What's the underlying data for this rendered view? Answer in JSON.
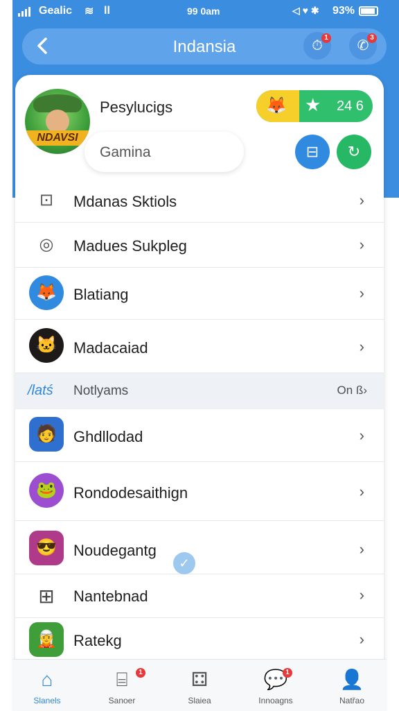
{
  "status_bar": {
    "carrier": "Gealic",
    "extra": "ll",
    "time": "99 0am",
    "icons": "◁ ♥ ✱",
    "battery": "93%"
  },
  "header": {
    "title": "Indansia",
    "back_icon": "chevron-left-icon",
    "alert_badge": "1",
    "chat_badge": "3"
  },
  "profile": {
    "name": "Pesylucigs",
    "subtitle": "Gamina",
    "avatar_tag": "NDAVSI",
    "score": "24 6"
  },
  "menu": [
    {
      "label": "Mdanas Sktiols",
      "icon": "bag-icon"
    },
    {
      "label": "Madues Sukpleg",
      "icon": "instagram-icon"
    },
    {
      "label": "Blatiang",
      "icon": "fox-avatar-icon"
    },
    {
      "label": "Madacaiad",
      "icon": "character-avatar-icon"
    }
  ],
  "section": {
    "icon_text": "/latś",
    "label": "Notlyams",
    "right": "On ß›"
  },
  "list": [
    {
      "label": "Ghdllodad"
    },
    {
      "label": "Rondodesaithign"
    },
    {
      "label": "Noudegantg"
    },
    {
      "label": "Nantebnad"
    },
    {
      "label": "Ratekg"
    }
  ],
  "tabs": [
    {
      "label": "Slanels",
      "icon": "home-icon",
      "active": true
    },
    {
      "label": "Sanoer",
      "icon": "store-icon",
      "badge": "1"
    },
    {
      "label": "Slaiea",
      "icon": "dice-icon"
    },
    {
      "label": "Innoagns",
      "icon": "chat-icon",
      "badge": "1"
    },
    {
      "label": "Natřao",
      "icon": "user-icon"
    }
  ]
}
